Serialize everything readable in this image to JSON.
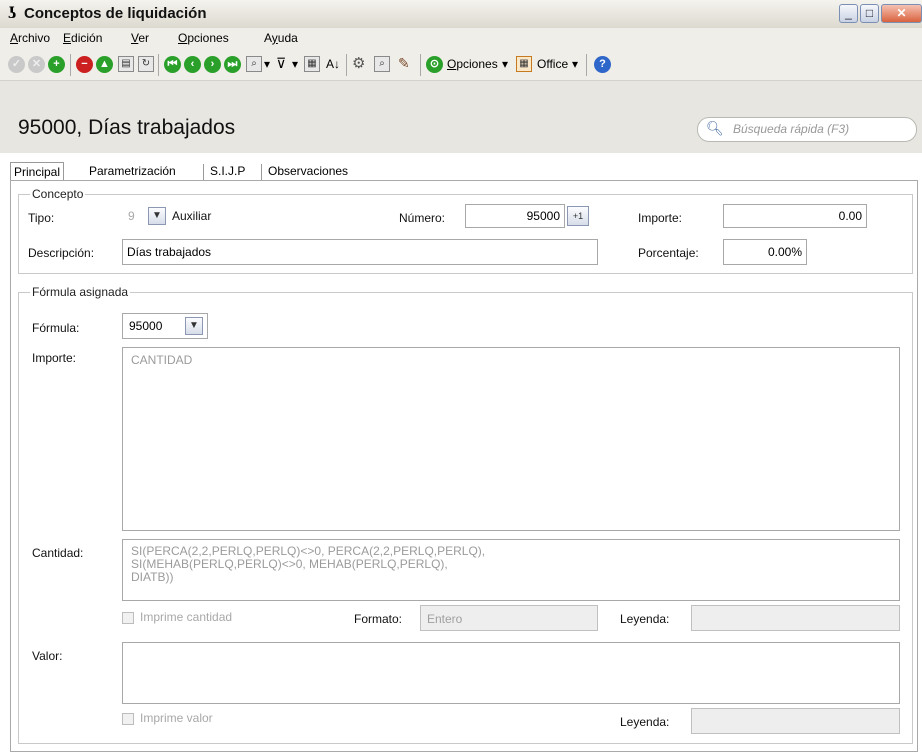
{
  "window": {
    "title": "Conceptos de liquidación",
    "controls": {
      "minimize": "_",
      "maximize": "□",
      "close": "✕"
    }
  },
  "menu": [
    {
      "pre": "",
      "key": "A",
      "post": "rchivo"
    },
    {
      "pre": "",
      "key": "E",
      "post": "dición"
    },
    {
      "pre": "",
      "key": "V",
      "post": "er"
    },
    {
      "pre": "",
      "key": "O",
      "post": "pciones"
    },
    {
      "pre": "A",
      "key": "y",
      "post": "uda"
    }
  ],
  "toolbar": {
    "opciones_label": "Opciones",
    "office_label": "Office",
    "dropdown_glyph": "▾"
  },
  "record": {
    "title": "95000, Días trabajados"
  },
  "search": {
    "placeholder": "Búsqueda rápida (F3)"
  },
  "tabs": [
    "Principal",
    "Parametrización",
    "S.I.J.P",
    "Observaciones"
  ],
  "concepto": {
    "group_title": "Concepto",
    "tipo_label": "Tipo:",
    "tipo_value": "9",
    "tipo_desc": "Auxiliar",
    "numero_label": "Número:",
    "numero_value": "95000",
    "numero_btn": "+1",
    "importe_label": "Importe:",
    "importe_value": "0.00",
    "descripcion_label": "Descripción:",
    "descripcion_value": "Días trabajados",
    "porcentaje_label": "Porcentaje:",
    "porcentaje_value": "0.00%"
  },
  "formula": {
    "group_title": "Fórmula asignada",
    "formula_label": "Fórmula:",
    "formula_value": "95000",
    "importe_label": "Importe:",
    "importe_value": "CANTIDAD",
    "cantidad_label": "Cantidad:",
    "cantidad_lines": [
      "SI(PERCA(2,2,PERLQ,PERLQ)<>0, PERCA(2,2,PERLQ,PERLQ),",
      "SI(MEHAB(PERLQ,PERLQ)<>0, MEHAB(PERLQ,PERLQ),",
      "DIATB))"
    ],
    "imprime_cantidad_label": "Imprime cantidad",
    "formato_label": "Formato:",
    "formato_value": "Entero",
    "leyenda_label": "Leyenda:",
    "valor_label": "Valor:",
    "imprime_valor_label": "Imprime valor",
    "leyenda2_label": "Leyenda:"
  }
}
